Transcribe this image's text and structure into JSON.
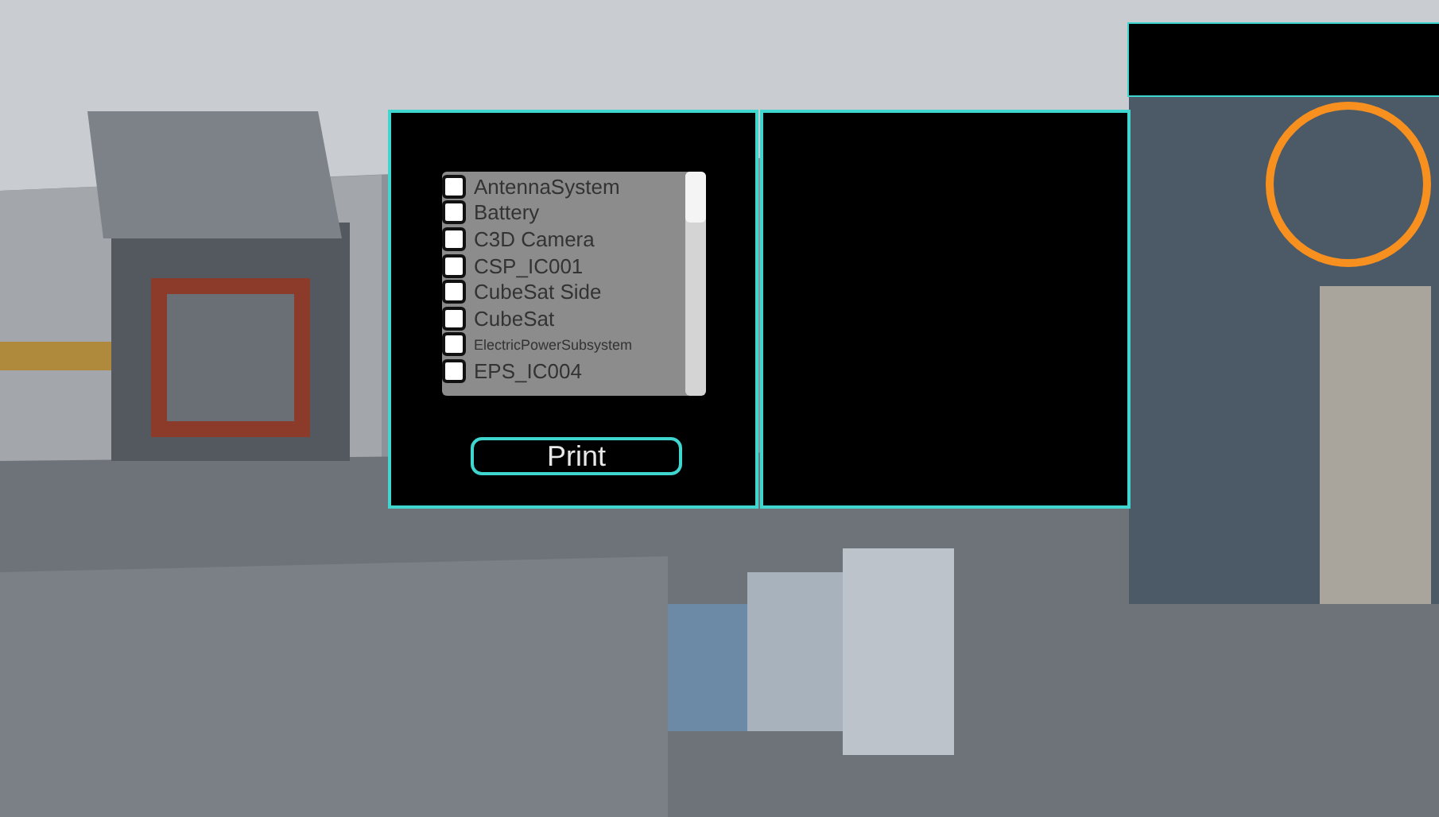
{
  "parts_panel": {
    "items": [
      {
        "label": "AntennaSystem",
        "kind": "normal",
        "checked": false
      },
      {
        "label": "Battery",
        "kind": "normal",
        "checked": false
      },
      {
        "label": "C3D Camera",
        "kind": "normal",
        "checked": false
      },
      {
        "label": "CSP_IC001",
        "kind": "normal",
        "checked": false
      },
      {
        "label": "CubeSat Side",
        "kind": "normal",
        "checked": false
      },
      {
        "label": "CubeSat",
        "kind": "normal",
        "checked": false
      },
      {
        "label": "ElectricPowerSubsystem",
        "kind": "compact",
        "checked": false
      },
      {
        "label": "EPS_IC004",
        "kind": "normal",
        "checked": false
      }
    ],
    "print_button": "Print"
  }
}
